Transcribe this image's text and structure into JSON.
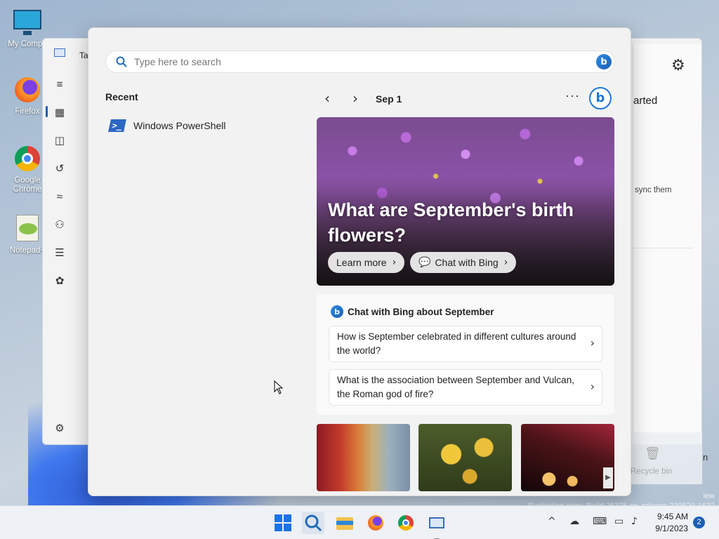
{
  "desktop": {
    "icons": [
      {
        "label": "My Compu"
      },
      {
        "label": "Firefox"
      },
      {
        "label": "Google Chrome"
      },
      {
        "label": "Notepad+"
      }
    ],
    "watermark_line1": "iew",
    "watermark_line2": "Evaluation copy. Build 25375.zn_release.230520-1632"
  },
  "taskmgr": {
    "title": "Ta",
    "right_heading": "arted",
    "right_text": "sync them",
    "recycle_label": "Recycle bin",
    "right_n": "n"
  },
  "search": {
    "placeholder": "Type here to search",
    "recent_title": "Recent",
    "recent_items": [
      {
        "label": "Windows PowerShell"
      }
    ],
    "date": "Sep 1",
    "hero_title": "What are September's birth flowers?",
    "learn_more": "Learn more",
    "chat_with_bing": "Chat with Bing",
    "chat_card_title": "Chat with Bing about September",
    "questions": [
      {
        "text": "How is September celebrated in different cultures around the world?"
      },
      {
        "text": "What is the association between September and Vulcan, the Roman god of fire?"
      }
    ]
  },
  "taskbar": {
    "time": "9:45 AM",
    "date": "9/1/2023",
    "notification_count": "2"
  }
}
